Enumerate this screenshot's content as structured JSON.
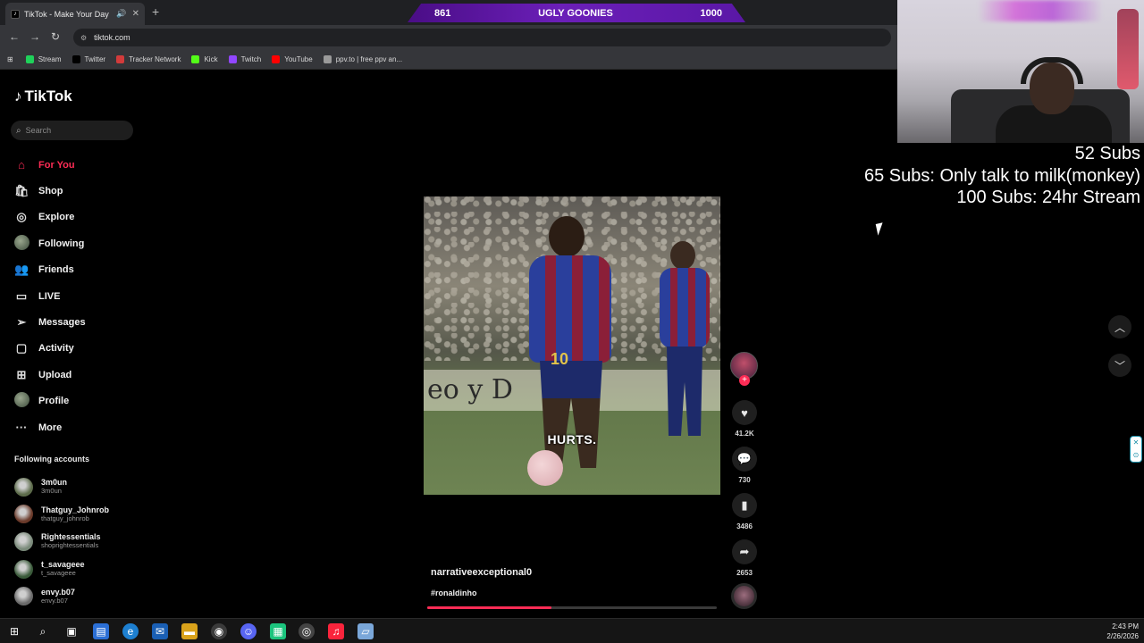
{
  "browser": {
    "tab_title": "TikTok - Make Your Day",
    "url": "tiktok.com",
    "bookmarks": [
      {
        "label": "Stream",
        "color": "#1fd15a"
      },
      {
        "label": "Twitter",
        "color": "#000000"
      },
      {
        "label": "Tracker Network",
        "color": "#d23b3b"
      },
      {
        "label": "Kick",
        "color": "#53fc18"
      },
      {
        "label": "Twitch",
        "color": "#9146ff"
      },
      {
        "label": "YouTube",
        "color": "#ff0000"
      },
      {
        "label": "ppv.to | free ppv an...",
        "color": "#9a9a9a"
      }
    ]
  },
  "overlay_bar": {
    "left_count": "861",
    "title": "UGLY GOONIES",
    "right_count": "1000"
  },
  "tiktok": {
    "logo_text": "TikTok",
    "search_placeholder": "Search",
    "accent": "#fe2c55",
    "nav": [
      {
        "label": "For You",
        "icon": "home-icon",
        "glyph": "⌂",
        "active": true
      },
      {
        "label": "Shop",
        "icon": "shop-bag-icon",
        "glyph": "🛍"
      },
      {
        "label": "Explore",
        "icon": "compass-icon",
        "glyph": "◎"
      },
      {
        "label": "Following",
        "icon": "avatar",
        "glyph": ""
      },
      {
        "label": "Friends",
        "icon": "friends-icon",
        "glyph": "👥"
      },
      {
        "label": "LIVE",
        "icon": "live-icon",
        "glyph": "▭"
      },
      {
        "label": "Messages",
        "icon": "send-icon",
        "glyph": "➢"
      },
      {
        "label": "Activity",
        "icon": "activity-icon",
        "glyph": "▢"
      },
      {
        "label": "Upload",
        "icon": "upload-icon",
        "glyph": "⊞"
      },
      {
        "label": "Profile",
        "icon": "avatar",
        "glyph": ""
      },
      {
        "label": "More",
        "icon": "more-icon",
        "glyph": "···"
      }
    ],
    "following_accounts_title": "Following accounts",
    "following_accounts": [
      {
        "name": "3m0un",
        "handle": "3m0un",
        "color": "#5c6b4a"
      },
      {
        "name": "Thatguy_Johnrob",
        "handle": "thatguy_johnrob",
        "color": "#6a3a2a"
      },
      {
        "name": "Rightessentials",
        "handle": "shoprightessentials",
        "color": "#7a8a7a"
      },
      {
        "name": "t_savageee",
        "handle": "t_savageee",
        "color": "#3a5a3a"
      },
      {
        "name": "envy.b07",
        "handle": "envy.b07",
        "color": "#6a6a6a"
      }
    ],
    "video": {
      "caption": "HURTS.",
      "board_text": "eo y D",
      "jersey_number": "10",
      "author": "narrativeexceptional0",
      "hashtag": "#ronaldinho",
      "progress": 0.43
    },
    "actions": {
      "likes": "41.2K",
      "comments": "730",
      "saves": "3486",
      "shares": "2653"
    }
  },
  "stream_overlay": {
    "subs_lines": [
      "52 Subs",
      "65 Subs: Only talk to milk(monkey)",
      "100 Subs: 24hr Stream"
    ]
  },
  "taskbar": {
    "time": "2:43 PM",
    "date": "2/26/2026"
  }
}
